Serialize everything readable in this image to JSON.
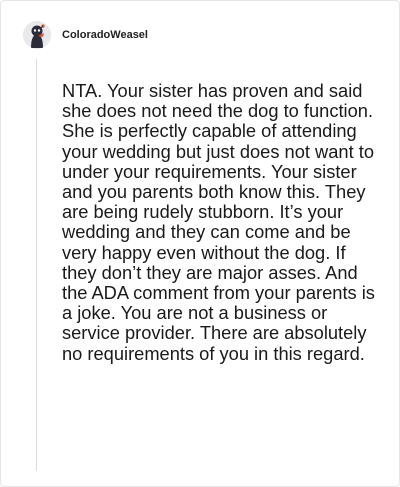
{
  "comment": {
    "author": "ColoradoWeasel",
    "avatar_icon": "snoo-avatar-icon",
    "text": "NTA. Your sister has proven and said she does not need the dog to function. She is perfectly capable of attending your wedding but just does not want to under your requirements. Your sister and you parents both know this. They are being rudely stubborn. It’s your wedding and they can come and be very happy even without the dog. If they don’t they are major asses. And the ADA comment from your parents is a joke. You are not a business or service provider. There are absolutely no requirements of you in this regard."
  },
  "colors": {
    "avatar_body": "#2b2b3a",
    "avatar_accent": "#e0552b",
    "thread_line": "#dcdcdc",
    "text": "#1a1a1a"
  }
}
